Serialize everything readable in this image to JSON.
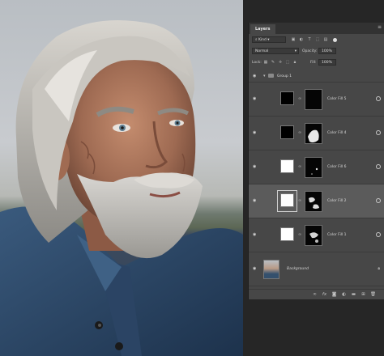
{
  "panel": {
    "tab_label": "Layers",
    "menu_icon": "hamburger-menu-icon",
    "filter": {
      "kind_label": "Kind"
    },
    "blend": {
      "mode": "Normal",
      "opacity_label": "Opacity:",
      "opacity_value": "100%"
    },
    "lock": {
      "label": "Lock:",
      "fill_label": "Fill:",
      "fill_value": "100%"
    },
    "group": {
      "name": "Group 1"
    },
    "layers": [
      {
        "name": "Color Fill 5",
        "fill_color": "#000000",
        "selected": false
      },
      {
        "name": "Color Fill 4",
        "fill_color": "#000000",
        "selected": false
      },
      {
        "name": "Color Fill 6",
        "fill_color": "#ffffff",
        "selected": false
      },
      {
        "name": "Color Fill 2",
        "fill_color": "#ffffff",
        "selected": true
      },
      {
        "name": "Color Fill 1",
        "fill_color": "#ffffff",
        "selected": false
      }
    ],
    "background_layer": {
      "name": "Background"
    }
  },
  "colors": {
    "panel_bg": "#474747",
    "selected_row": "#5b5b5b",
    "dark_bg": "#262626"
  }
}
